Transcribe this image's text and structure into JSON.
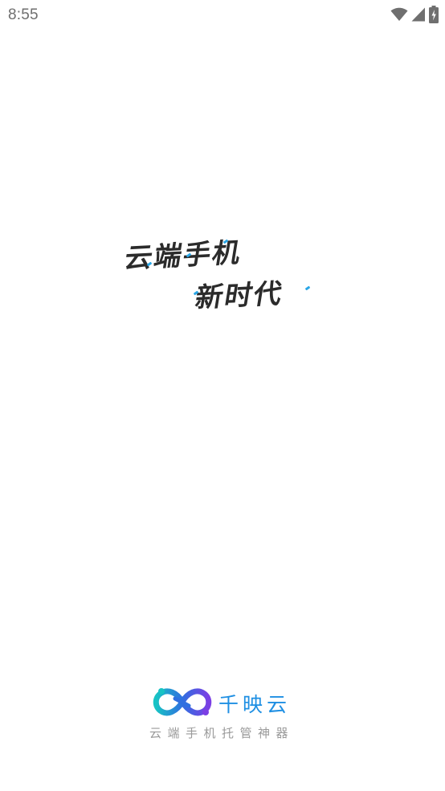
{
  "status_bar": {
    "time": "8:55",
    "icons": [
      "wifi-icon",
      "cellular-signal-icon",
      "battery-charging-icon"
    ],
    "icon_color": "#6f6f6f"
  },
  "splash": {
    "slogan_line_1": "云端手机",
    "slogan_line_2": "新时代",
    "slogan_color": "#2b2b2b",
    "accent_color": "#2aa6e6"
  },
  "brand": {
    "name": "千映云",
    "tagline": "云端手机托管神器",
    "name_color": "#1e8fe3",
    "logo_colors": [
      "#18c3c4",
      "#2f6fe0",
      "#7b3fe4"
    ],
    "logo_icon": "infinity-loop-logo"
  }
}
